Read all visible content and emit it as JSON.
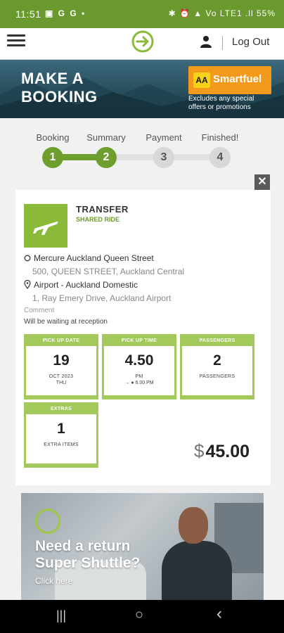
{
  "status_bar": {
    "time": "11:51",
    "left_icons": "▣ G G •",
    "right_icons": "✱ ⏰ ▲ Vo LTE1 .ll",
    "battery": "55%"
  },
  "header": {
    "logo_icon": "super-shuttle-logo-icon",
    "menu_icon": "hamburger-icon",
    "user_icon": "user-icon",
    "logout_label": "Log Out"
  },
  "banner": {
    "title_line1": "MAKE A",
    "title_line2": "BOOKING",
    "brand_badge": "AA",
    "brand_name": "Smartfuel",
    "note": "Excludes any special offers or promotions"
  },
  "steps": [
    {
      "label": "Booking",
      "number": "1",
      "status": "complete"
    },
    {
      "label": "Summary",
      "number": "2",
      "status": "active"
    },
    {
      "label": "Payment",
      "number": "3",
      "status": "pending"
    },
    {
      "label": "Finished!",
      "number": "4",
      "status": "pending"
    }
  ],
  "close_label": "✕",
  "booking": {
    "type": "TRANSFER",
    "subtype": "SHARED RIDE",
    "pickup": {
      "name": "Mercure Auckland Queen Street",
      "address": "500, QUEEN STREET, Auckland Central"
    },
    "dropoff": {
      "name": "Airport - Auckland Domestic",
      "address": "1, Ray Emery Drive, Auckland Airport"
    },
    "comment_label": "Comment",
    "comment": "Will be waiting at reception",
    "tiles": {
      "date": {
        "header": "PICK UP DATE",
        "value": "19",
        "line1": "OCT 2023",
        "line2": "THU"
      },
      "time": {
        "header": "PICK UP TIME",
        "value": "4.50",
        "line1": "PM",
        "line2": "→ ● 6.00 PM"
      },
      "passengers": {
        "header": "PASSENGERS",
        "value": "2",
        "line1": "PASSENGERS"
      },
      "extras": {
        "header": "EXTRAS",
        "value": "1",
        "line1": "EXTRA ITEMS"
      }
    },
    "currency": "$",
    "price": "45.00"
  },
  "promo": {
    "line1": "Need a return",
    "line2": "Super Shuttle?",
    "cta": "Click here"
  },
  "nav": {
    "recent": "|||",
    "home": "○",
    "back": "‹"
  },
  "colors": {
    "brand_green": "#6e9e2e",
    "tile_green": "#a3c95a",
    "status_green": "#6a9a2e",
    "aa_orange": "#f39a1d"
  }
}
